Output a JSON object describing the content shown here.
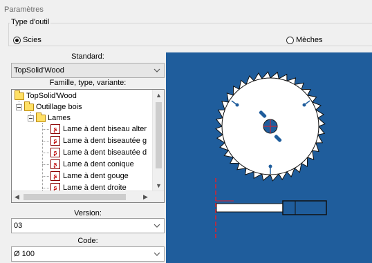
{
  "window": {
    "title": "Paramètres"
  },
  "tool_type": {
    "label": "Type d'outil",
    "options": [
      {
        "label": "Scies",
        "selected": true
      },
      {
        "label": "Mèches",
        "selected": false
      }
    ]
  },
  "standard": {
    "label": "Standard:",
    "value": "TopSolid'Wood"
  },
  "family": {
    "label": "Famille, type, variante:",
    "tree": [
      {
        "label": "TopSolid'Wood",
        "icon": "folder-icon"
      },
      {
        "label": "Outillage bois",
        "icon": "folder-icon"
      },
      {
        "label": "Lames",
        "icon": "folder-icon"
      },
      {
        "label": "Lame à dent biseau alter",
        "icon": "saw-blade-icon"
      },
      {
        "label": "Lame à dent biseautée g",
        "icon": "saw-blade-icon"
      },
      {
        "label": "Lame à dent biseautée d",
        "icon": "saw-blade-icon"
      },
      {
        "label": "Lame à dent conique",
        "icon": "saw-blade-icon"
      },
      {
        "label": "Lame à dent gouge",
        "icon": "saw-blade-icon"
      },
      {
        "label": "Lame à dent droite",
        "icon": "saw-blade-icon"
      }
    ]
  },
  "version": {
    "label": "Version:",
    "value": "03"
  },
  "code": {
    "label": "Code:",
    "value": "Ø 100"
  },
  "colors": {
    "preview_background": "#1f5d9c",
    "blade_fill": "#ffffff",
    "axis_red": "#e0202a"
  }
}
